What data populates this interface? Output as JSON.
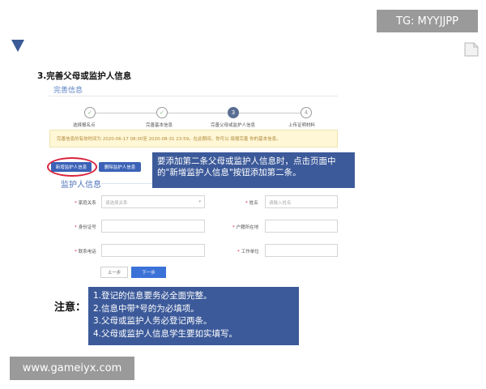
{
  "watermark_top": "TG: MYYJJPP",
  "watermark_bottom": "www.gameiyx.com",
  "heading": "3.完善父母或监护人信息",
  "form": {
    "header": "完善信息",
    "steps": [
      {
        "num": "✓",
        "label": "选择报名点"
      },
      {
        "num": "✓",
        "label": "完善基本信息"
      },
      {
        "num": "3",
        "label": "完善父母或监护人信息"
      },
      {
        "num": "4",
        "label": "上传证明材料"
      }
    ],
    "notice": "完善信息的有效时间为 2020-06-17 08:30至 2020-08-31 23:59。在此期间，你可以 填报完善 你的基本信息。",
    "add_button": "新增监护人信息",
    "delete_button": "删除监护人信息",
    "section_title": "监护人信息",
    "fields": {
      "relation_label": "家庭关系",
      "relation_placeholder": "请选择关系",
      "name_label": "姓名",
      "name_placeholder": "请输入姓名",
      "id_label": "身份证号",
      "residence_label": "户籍所在地",
      "phone_label": "联系电话",
      "employer_label": "工作单位"
    },
    "prev_button": "上一步",
    "next_button": "下一步"
  },
  "callout": "要添加第二条父母或监护人信息时，点击页面中的\"新增监护人信息\"按钮添加第二条。",
  "note_label": "注意：",
  "notes": [
    "1.登记的信息要务必全面完整。",
    "2.信息中带*号的为必填项。",
    "3.父母或监护人务必登记两条。",
    "4.父母或监护人信息学生要如实填写。"
  ],
  "colors": {
    "callout_bg": "#3c5a9a",
    "primary_button": "#3b62b7",
    "highlight_ring": "#d9233d",
    "watermark_bg": "#9a9a9a"
  }
}
